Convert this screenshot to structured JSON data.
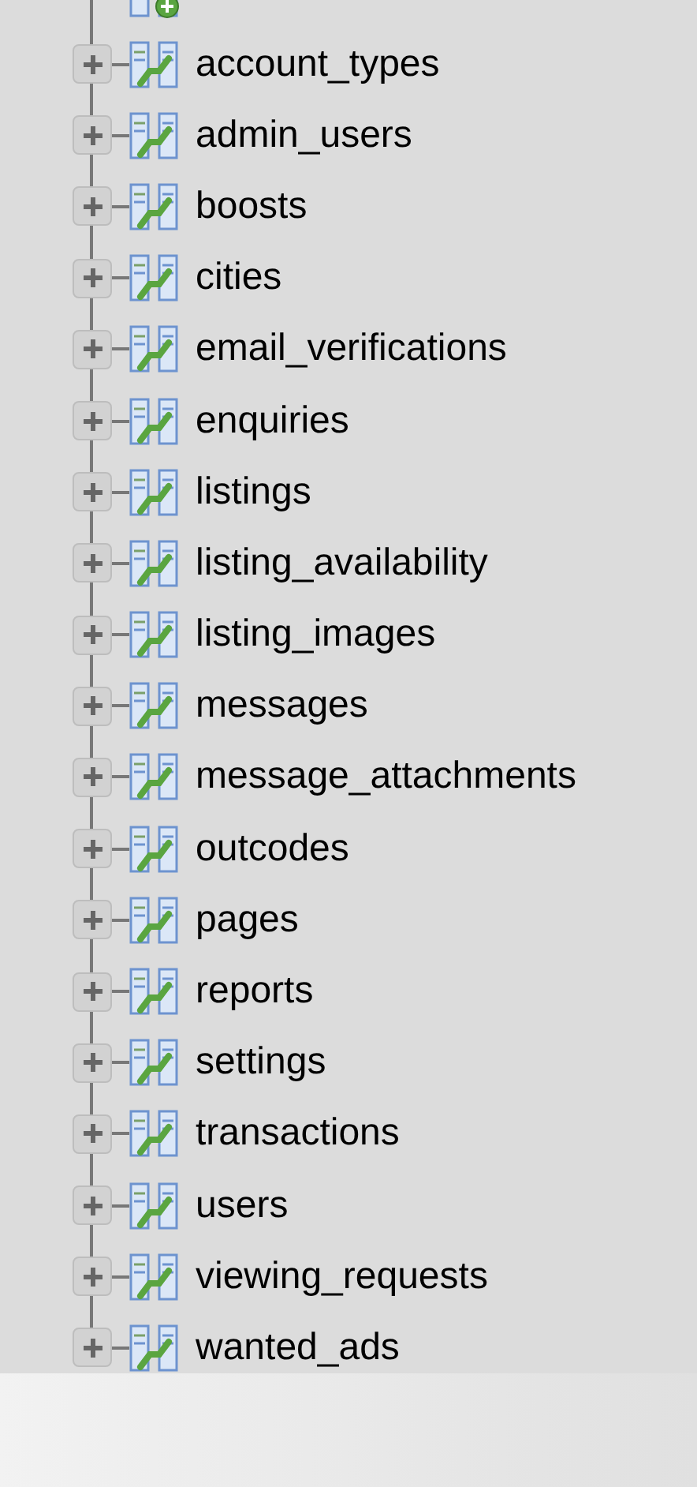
{
  "tables": [
    {
      "label": "account_types",
      "expanded": false
    },
    {
      "label": "admin_users",
      "expanded": false
    },
    {
      "label": "boosts",
      "expanded": false
    },
    {
      "label": "cities",
      "expanded": false
    },
    {
      "label": "email_verifications",
      "expanded": false
    },
    {
      "label": "enquiries",
      "expanded": false
    },
    {
      "label": "listings",
      "expanded": false
    },
    {
      "label": "listing_availability",
      "expanded": false
    },
    {
      "label": "listing_images",
      "expanded": false
    },
    {
      "label": "messages",
      "expanded": false
    },
    {
      "label": "message_attachments",
      "expanded": false
    },
    {
      "label": "outcodes",
      "expanded": false
    },
    {
      "label": "pages",
      "expanded": false
    },
    {
      "label": "reports",
      "expanded": false
    },
    {
      "label": "settings",
      "expanded": false
    },
    {
      "label": "transactions",
      "expanded": false
    },
    {
      "label": "users",
      "expanded": false
    },
    {
      "label": "viewing_requests",
      "expanded": false
    },
    {
      "label": "wanted_ads",
      "expanded": false
    }
  ]
}
